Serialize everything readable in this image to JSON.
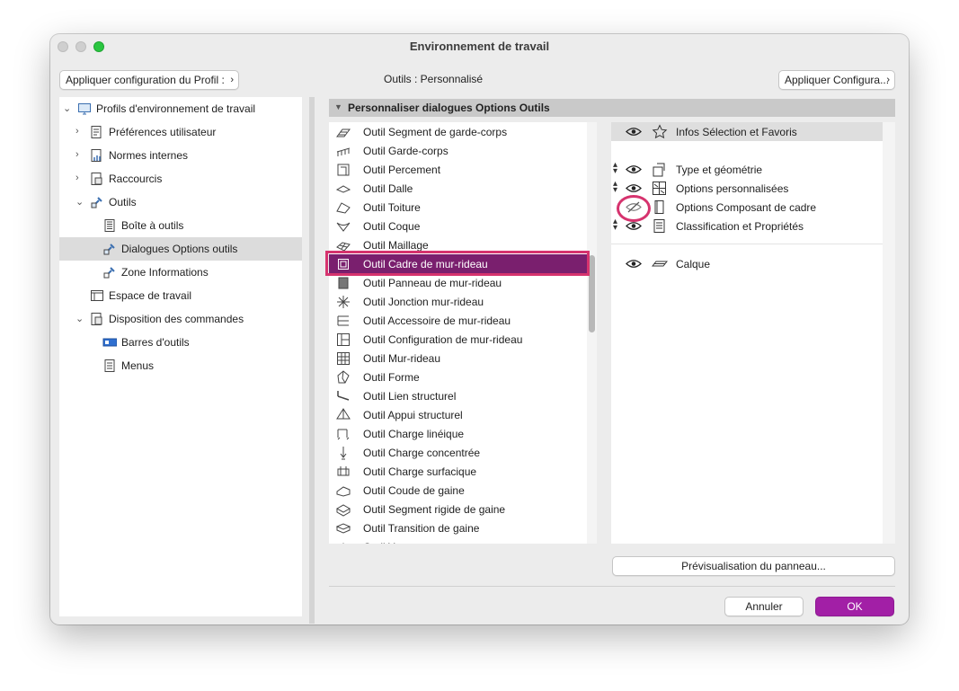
{
  "window": {
    "title": "Environnement de travail"
  },
  "toolbar": {
    "apply_profile_label": "Appliquer configuration du Profil :",
    "profile_text": "Outils : Personnalisé",
    "apply_config_label": "Appliquer Configura..."
  },
  "tree": {
    "items": [
      {
        "label": "Profils d'environnement de travail",
        "icon": "profile-icon",
        "arrow": "⌄"
      },
      {
        "label": "Préférences utilisateur",
        "icon": "preferences-icon",
        "arrow": "›"
      },
      {
        "label": "Normes internes",
        "icon": "standards-icon",
        "arrow": "›"
      },
      {
        "label": "Raccourcis",
        "icon": "shortcuts-icon",
        "arrow": "›"
      },
      {
        "label": "Outils",
        "icon": "tools-icon",
        "arrow": "⌄"
      },
      {
        "label": "Boîte à outils",
        "icon": "toolbox-icon",
        "arrow": ""
      },
      {
        "label": "Dialogues Options outils",
        "icon": "tool-settings-icon",
        "arrow": "",
        "selected": true
      },
      {
        "label": "Zone Informations",
        "icon": "info-box-icon",
        "arrow": ""
      },
      {
        "label": "Espace de travail",
        "icon": "workspace-icon",
        "arrow": ""
      },
      {
        "label": "Disposition des commandes",
        "icon": "command-layout-icon",
        "arrow": "⌄"
      },
      {
        "label": "Barres d'outils",
        "icon": "toolbars-icon",
        "arrow": ""
      },
      {
        "label": "Menus",
        "icon": "menus-icon",
        "arrow": ""
      }
    ]
  },
  "section": {
    "title": "Personnaliser dialogues Options Outils"
  },
  "tools": [
    {
      "label": "Outil Segment de garde-corps",
      "icon": "railing-segment-icon"
    },
    {
      "label": "Outil Garde-corps",
      "icon": "railing-icon"
    },
    {
      "label": "Outil Percement",
      "icon": "opening-icon"
    },
    {
      "label": "Outil Dalle",
      "icon": "slab-icon"
    },
    {
      "label": "Outil Toiture",
      "icon": "roof-icon"
    },
    {
      "label": "Outil Coque",
      "icon": "shell-icon"
    },
    {
      "label": "Outil Maillage",
      "icon": "mesh-icon"
    },
    {
      "label": "Outil Cadre de mur-rideau",
      "icon": "curtain-wall-frame-icon",
      "selected": true
    },
    {
      "label": "Outil Panneau de mur-rideau",
      "icon": "curtain-wall-panel-icon"
    },
    {
      "label": "Outil Jonction mur-rideau",
      "icon": "curtain-wall-junction-icon"
    },
    {
      "label": "Outil Accessoire de mur-rideau",
      "icon": "curtain-wall-accessory-icon"
    },
    {
      "label": "Outil Configuration de mur-rideau",
      "icon": "curtain-wall-layout-icon"
    },
    {
      "label": "Outil Mur-rideau",
      "icon": "curtain-wall-icon"
    },
    {
      "label": "Outil Forme",
      "icon": "morph-icon"
    },
    {
      "label": "Outil Lien structurel",
      "icon": "structural-link-icon"
    },
    {
      "label": "Outil Appui structurel",
      "icon": "structural-support-icon"
    },
    {
      "label": "Outil Charge linéique",
      "icon": "line-load-icon"
    },
    {
      "label": "Outil Charge concentrée",
      "icon": "point-load-icon"
    },
    {
      "label": "Outil Charge surfacique",
      "icon": "surface-load-icon"
    },
    {
      "label": "Outil Coude de gaine",
      "icon": "duct-bend-icon"
    },
    {
      "label": "Outil Segment rigide de gaine",
      "icon": "duct-segment-icon"
    },
    {
      "label": "Outil Transition de gaine",
      "icon": "duct-transition-icon"
    },
    {
      "label": "Outil Y...",
      "icon": "duct-y-icon"
    }
  ],
  "options": {
    "header": {
      "label": "Infos Sélection et Favoris",
      "icon": "star-icon"
    },
    "panels": [
      {
        "label": "Type et géométrie",
        "icon": "type-geometry-icon",
        "visible": true
      },
      {
        "label": "Options personnalisées",
        "icon": "custom-settings-icon",
        "visible": true
      },
      {
        "label": "Options Composant de cadre",
        "icon": "frame-component-icon",
        "visible": false
      },
      {
        "label": "Classification et Propriétés",
        "icon": "classification-icon",
        "visible": true
      }
    ],
    "footer": {
      "label": "Calque",
      "icon": "layer-icon"
    }
  },
  "buttons": {
    "preview": "Prévisualisation du panneau...",
    "cancel": "Annuler",
    "ok": "OK"
  },
  "colors": {
    "selection": "#7a1f6e",
    "ok_button": "#a21fa6",
    "annotation": "#d6336e"
  }
}
